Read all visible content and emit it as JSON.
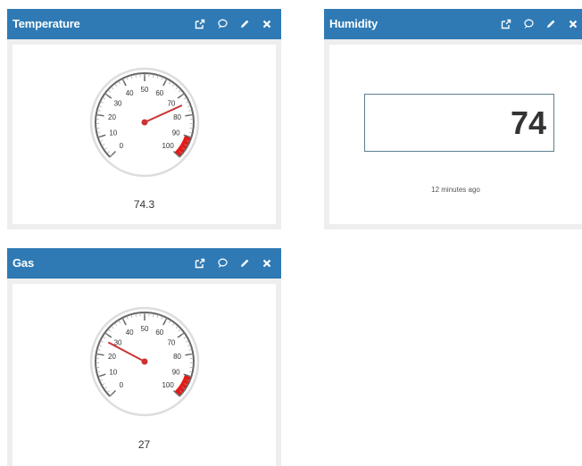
{
  "panels": {
    "temperature": {
      "title": "Temperature",
      "value": 74.3,
      "value_label": "74.3",
      "scale": {
        "min": 0,
        "max": 100,
        "labels": [
          "0",
          "10",
          "20",
          "30",
          "40",
          "50",
          "60",
          "70",
          "80",
          "90",
          "100"
        ]
      },
      "red_zone": [
        90,
        100
      ]
    },
    "humidity": {
      "title": "Humidity",
      "value": "74",
      "updated": "12 minutes ago"
    },
    "gas": {
      "title": "Gas",
      "value": 27,
      "value_label": "27",
      "scale": {
        "min": 0,
        "max": 100,
        "labels": [
          "0",
          "10",
          "20",
          "30",
          "40",
          "50",
          "60",
          "70",
          "80",
          "90",
          "100"
        ]
      },
      "red_zone": [
        90,
        100
      ]
    }
  },
  "header_icons": [
    "external-link-icon",
    "comment-icon",
    "pencil-icon",
    "close-icon"
  ],
  "colors": {
    "header": "#2f7ab4",
    "panel_bg": "#eeeeee",
    "needle": "#cc3333",
    "red_zone": "#e41b17"
  }
}
